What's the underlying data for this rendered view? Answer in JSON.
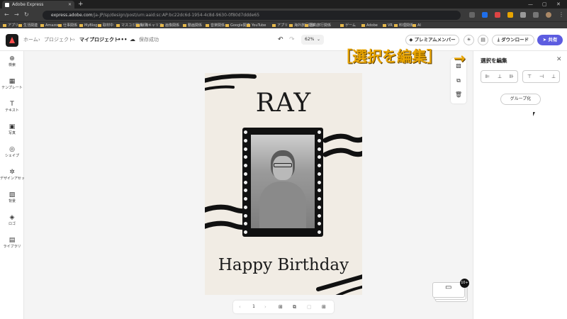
{
  "browser": {
    "tab_title": "Adobe Express",
    "url_host": "express.adobe.com",
    "url_path": "/ja-JP/sp/design/post/urn:aaid:sc:AP:bc22dc6d-1954-4c8d-9630-0f80d7ddde65",
    "bookmarks": [
      "アプリ",
      "生活関連",
      "Amazon",
      "仕事関係",
      "MyBlog",
      "取材中",
      "マスコミ関係",
      "就職キャリア",
      "画像関係",
      "動画関係",
      "音楽関係",
      "Google関連",
      "YouTube",
      "アプリ",
      "海外旅行関係",
      "国内旅行関係",
      "ゲーム",
      "Adobe",
      "VR",
      "料理関係",
      "AI"
    ]
  },
  "header": {
    "breadcrumb_home": "ホーム",
    "breadcrumb_project": "プロジェクト",
    "breadcrumb_current": "マイプロジェクト",
    "more": "•••",
    "save_status": "保存成功",
    "zoom": "62%",
    "premium_label": "プレミアムメンバー",
    "download_label": "ダウンロード",
    "share_label": "共有"
  },
  "left_rail": {
    "items": [
      {
        "label": "検索",
        "icon": "⊕"
      },
      {
        "label": "テンプレート",
        "icon": "▦"
      },
      {
        "label": "テキスト",
        "icon": "T"
      },
      {
        "label": "写真",
        "icon": "▣"
      },
      {
        "label": "シェイプ",
        "icon": "◎"
      },
      {
        "label": "デザインアセット",
        "icon": "✲"
      },
      {
        "label": "背景",
        "icon": "▨"
      },
      {
        "label": "ロゴ",
        "icon": "◈"
      },
      {
        "label": "ライブラリ",
        "icon": "▤"
      }
    ]
  },
  "card": {
    "title": "RAY",
    "subtitle": "Happy Birthday"
  },
  "page_bar": {
    "page_number": "1",
    "thumb_badge": "10+"
  },
  "right_panel": {
    "title": "選択を編集",
    "group_button": "グループ化"
  },
  "annotation": {
    "text": "［選択を編集］",
    "arrow": "→"
  },
  "colors": {
    "accent": "#5c5ce0",
    "annotation": "#e8a400"
  }
}
